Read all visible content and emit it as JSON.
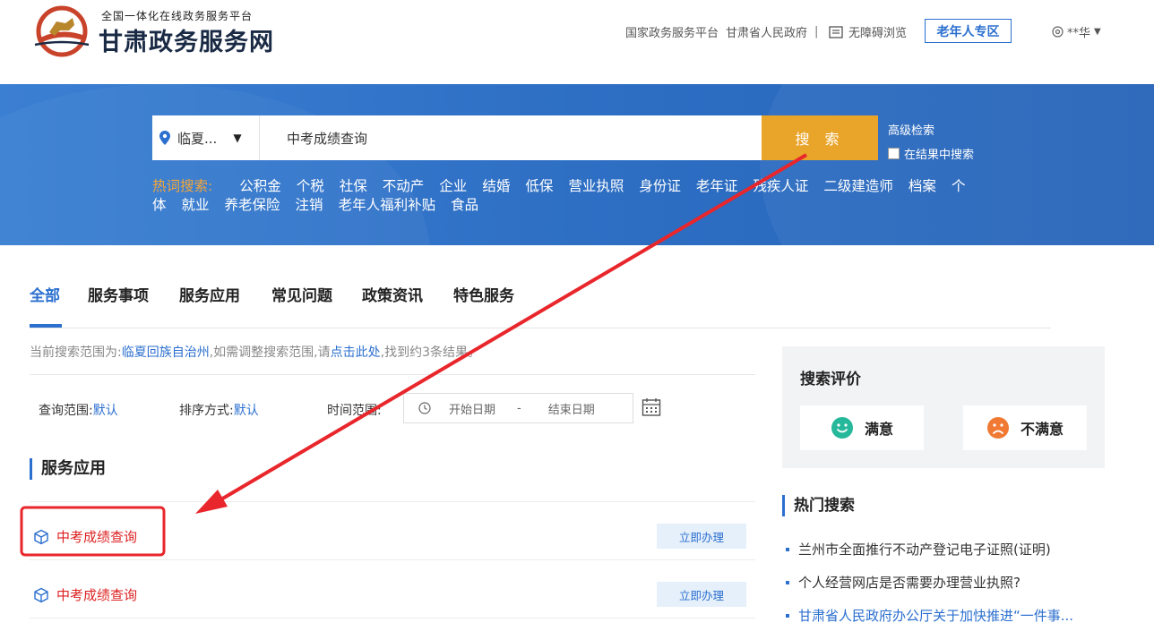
{
  "header": {
    "logo_subtitle": "全国一体化在线政务服务平台",
    "logo_title": "甘肃政务服务网",
    "links": [
      "国家政务服务平台",
      "甘肃省人民政府"
    ],
    "link_separator": "|",
    "accessibility": "无障碍浏览",
    "elder_zone": "老年人专区",
    "user_name": "**华"
  },
  "search": {
    "region": "临夏...",
    "query": "中考成绩查询",
    "button": "搜 索",
    "advanced": "高级检索",
    "in_results": "在结果中搜索",
    "hot_label": "热词搜索:",
    "hot_words": [
      "公积金",
      "个税",
      "社保",
      "不动产",
      "企业",
      "结婚",
      "低保",
      "营业执照",
      "身份证",
      "老年证",
      "残疾人证",
      "二级建造师",
      "档案",
      "个体",
      "就业",
      "养老保险",
      "注销",
      "老年人福利补贴",
      "食品"
    ]
  },
  "tabs": [
    "全部",
    "服务事项",
    "服务应用",
    "常见问题",
    "政策资讯",
    "特色服务"
  ],
  "scope": {
    "prefix": "当前搜索范围为:",
    "region": "临夏回族自治州",
    "middle": ",如需调整搜索范围,请",
    "link": "点击此处",
    "suffix": ",找到约3条结果。"
  },
  "filters": {
    "range_label": "查询范围:",
    "range_value": "默认",
    "sort_label": "排序方式:",
    "sort_value": "默认",
    "time_label": "时间范围:",
    "start_placeholder": "开始日期",
    "date_sep": "-",
    "end_placeholder": "结束日期"
  },
  "section_title": "服务应用",
  "results": [
    {
      "title": "中考成绩查询",
      "action": "立即办理"
    },
    {
      "title": "中考成绩查询",
      "action": "立即办理"
    }
  ],
  "evaluation": {
    "title": "搜索评价",
    "satisfied": "满意",
    "unsatisfied": "不满意"
  },
  "hot_search": {
    "title": "热门搜索",
    "items": [
      "兰州市全面推行不动产登记电子证照(证明)",
      "个人经营网店是否需要办理营业执照?",
      "甘肃省人民政府办公厅关于加快推进“一件事..."
    ]
  },
  "colors": {
    "accent": "#2b6fcf",
    "search_button": "#e9a42a",
    "result_title": "#dd2222",
    "annotation": "#e8262b"
  }
}
